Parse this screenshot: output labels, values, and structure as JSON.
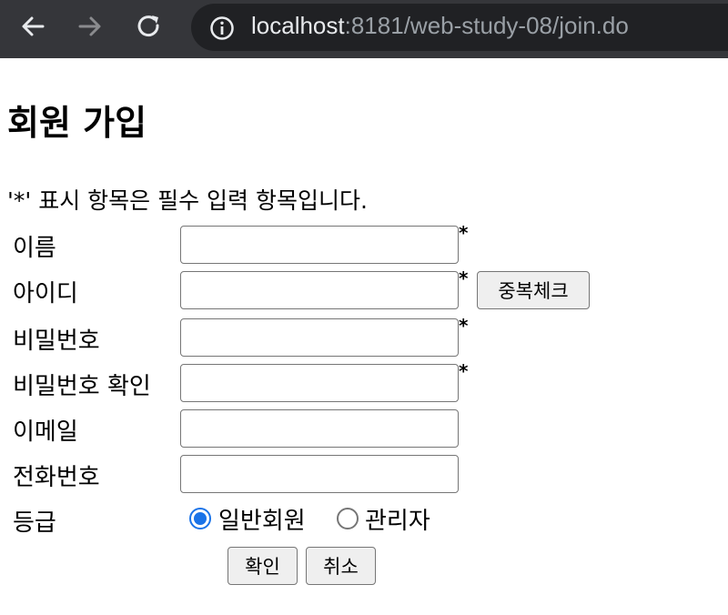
{
  "browser": {
    "back_icon": "arrow-left-icon",
    "forward_icon": "arrow-right-icon",
    "reload_icon": "reload-icon",
    "site_info_icon": "info-icon",
    "url_host": "localhost",
    "url_rest": ":8181/web-study-08/join.do"
  },
  "form": {
    "title": "회원 가입",
    "notice": "'*' 표시 항목은 필수 입력 항목입니다.",
    "required_mark": "*",
    "fields": {
      "name": {
        "label": "이름",
        "value": ""
      },
      "userid": {
        "label": "아이디",
        "value": ""
      },
      "password": {
        "label": "비밀번호",
        "value": ""
      },
      "password_confirm": {
        "label": "비밀번호 확인",
        "value": ""
      },
      "email": {
        "label": "이메일",
        "value": ""
      },
      "phone": {
        "label": "전화번호",
        "value": ""
      }
    },
    "dup_check_label": "중복체크",
    "grade": {
      "label": "등급",
      "options": [
        "일반회원",
        "관리자"
      ],
      "selected": "일반회원"
    },
    "submit_label": "확인",
    "cancel_label": "취소"
  },
  "colors": {
    "toolbar_bg": "#35363a",
    "omnibox_bg": "#202124",
    "radio_accent": "#1a73e8"
  }
}
